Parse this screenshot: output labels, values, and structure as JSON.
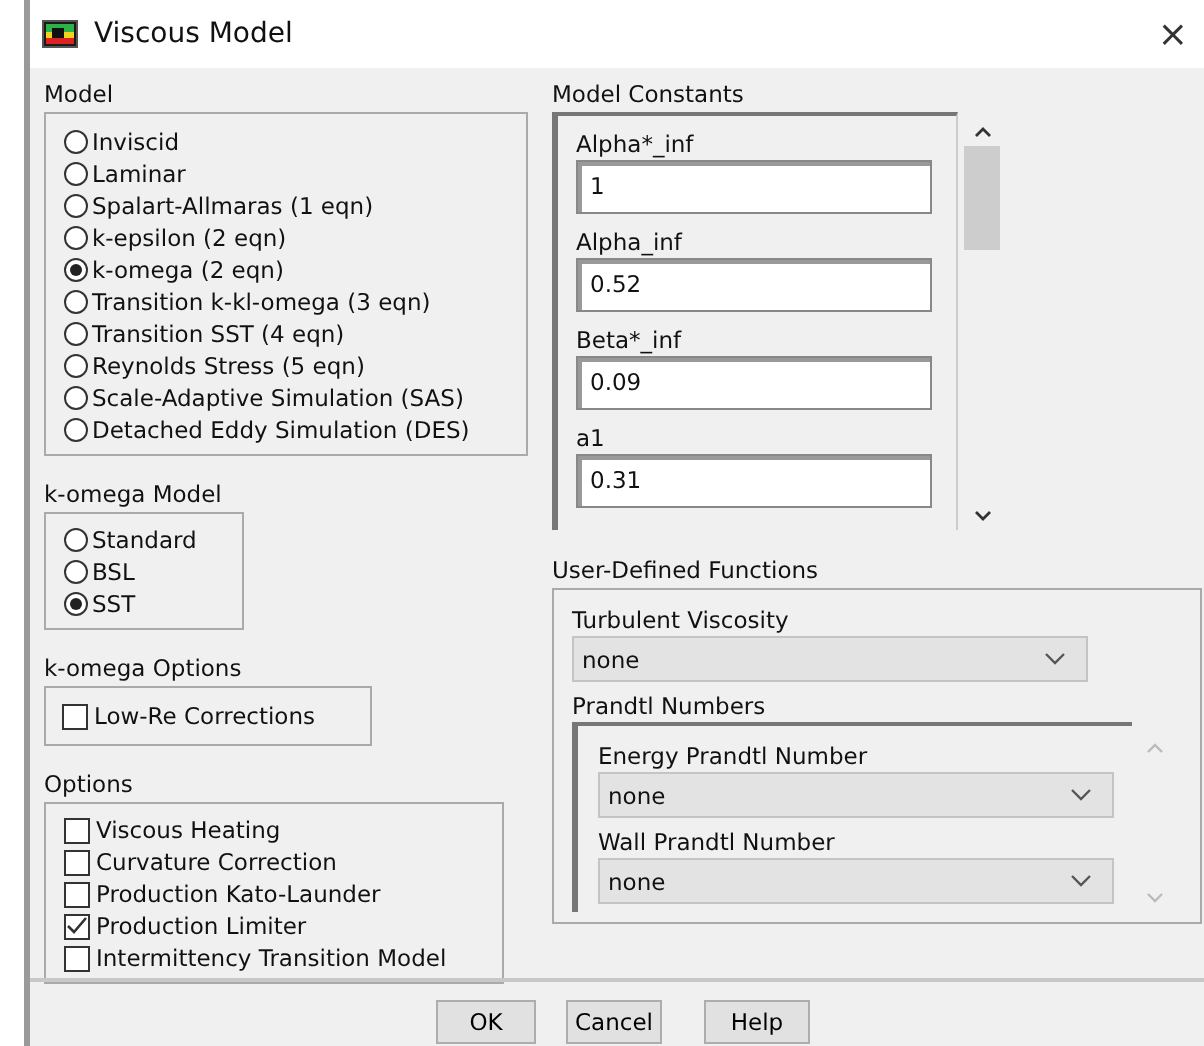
{
  "window": {
    "title": "Viscous Model",
    "close": "×"
  },
  "model": {
    "label": "Model",
    "options": [
      {
        "label": "Inviscid",
        "selected": false
      },
      {
        "label": "Laminar",
        "selected": false
      },
      {
        "label": "Spalart-Allmaras (1 eqn)",
        "selected": false
      },
      {
        "label": "k-epsilon (2 eqn)",
        "selected": false
      },
      {
        "label": "k-omega (2 eqn)",
        "selected": true
      },
      {
        "label": "Transition k-kl-omega (3 eqn)",
        "selected": false
      },
      {
        "label": "Transition SST (4 eqn)",
        "selected": false
      },
      {
        "label": "Reynolds Stress (5 eqn)",
        "selected": false
      },
      {
        "label": "Scale-Adaptive Simulation (SAS)",
        "selected": false
      },
      {
        "label": "Detached Eddy Simulation (DES)",
        "selected": false
      }
    ]
  },
  "komega_model": {
    "label": "k-omega Model",
    "options": [
      {
        "label": "Standard",
        "selected": false
      },
      {
        "label": "BSL",
        "selected": false
      },
      {
        "label": "SST",
        "selected": true
      }
    ]
  },
  "komega_options": {
    "label": "k-omega Options",
    "options": [
      {
        "label": "Low-Re Corrections",
        "checked": false
      }
    ]
  },
  "options": {
    "label": "Options",
    "options": [
      {
        "label": "Viscous Heating",
        "checked": false
      },
      {
        "label": "Curvature Correction",
        "checked": false
      },
      {
        "label": "Production Kato-Launder",
        "checked": false
      },
      {
        "label": "Production Limiter",
        "checked": true
      },
      {
        "label": "Intermittency Transition Model",
        "checked": false
      }
    ]
  },
  "model_constants": {
    "label": "Model Constants",
    "fields": [
      {
        "label": "Alpha*_inf",
        "value": "1"
      },
      {
        "label": "Alpha_inf",
        "value": "0.52"
      },
      {
        "label": "Beta*_inf",
        "value": "0.09"
      },
      {
        "label": "a1",
        "value": "0.31"
      }
    ]
  },
  "udf": {
    "label": "User-Defined Functions",
    "turbulent_viscosity": {
      "label": "Turbulent Viscosity",
      "value": "none"
    },
    "prandtl": {
      "label": "Prandtl Numbers",
      "fields": [
        {
          "label": "Energy Prandtl Number",
          "value": "none"
        },
        {
          "label": "Wall Prandtl Number",
          "value": "none"
        }
      ]
    }
  },
  "buttons": [
    "OK",
    "Cancel",
    "Help"
  ]
}
